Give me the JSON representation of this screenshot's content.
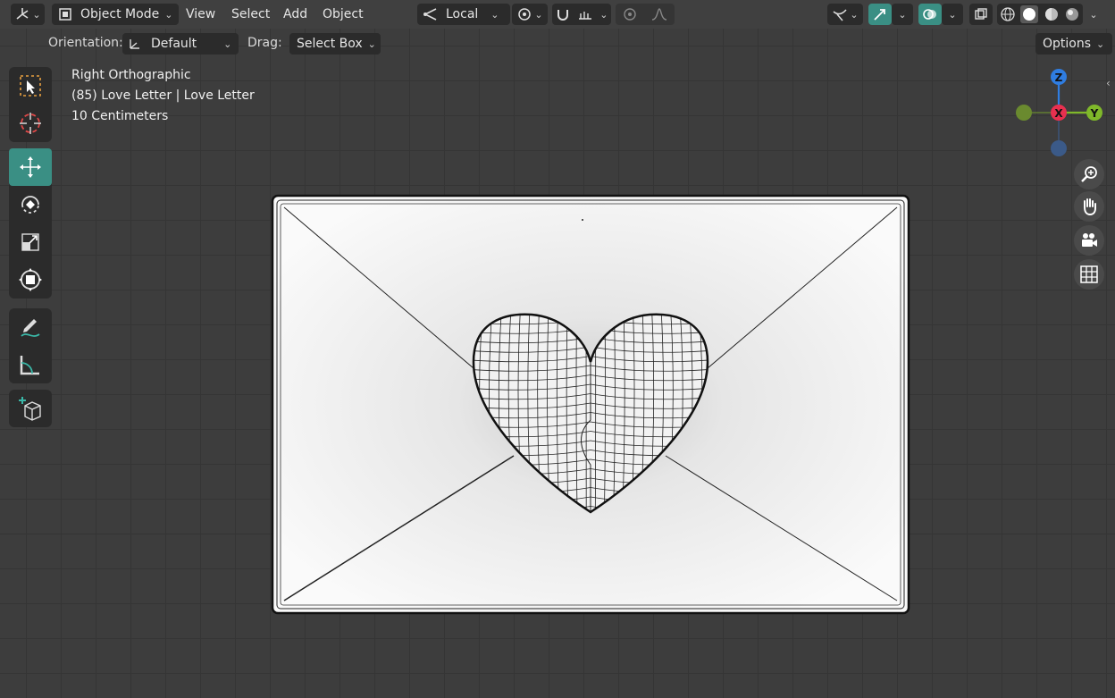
{
  "header": {
    "editor_type_icon": "orbit-axes-icon",
    "mode": {
      "label": "Object Mode",
      "icon": "object-cube-icon"
    },
    "menu": [
      "View",
      "Select",
      "Add",
      "Object"
    ],
    "transform_orientation": {
      "label": "Local",
      "icon": "local-axis-icon"
    }
  },
  "tool_settings": {
    "orientation_label": "Orientation:",
    "orientation_value": "Default",
    "drag_label": "Drag:",
    "drag_value": "Select Box",
    "options_label": "Options"
  },
  "overlay_info": {
    "view_name": "Right Orthographic",
    "object_info": "(85) Love Letter | Love Letter",
    "scale": "10 Centimeters"
  },
  "gizmo": {
    "axes": [
      {
        "label": "Z",
        "color": "#2f7de1"
      },
      {
        "label": "X",
        "color": "#e8304f"
      },
      {
        "label": "Y",
        "color": "#7fb82a"
      }
    ],
    "neg_y_color": "#6a8a2f",
    "neg_z_color": "#3b5a88"
  },
  "colors": {
    "accent": "#3a8f84",
    "header_bg": "#404040",
    "viewport_bg": "#3d3d3d"
  },
  "tools": [
    "select-box-icon",
    "cursor-icon",
    "move-icon",
    "rotate-icon",
    "scale-icon",
    "transform-icon",
    "annotate-icon",
    "measure-icon",
    "add-cube-icon"
  ],
  "nav_buttons": [
    "zoom-icon",
    "pan-hand-icon",
    "camera-icon",
    "grid-icon"
  ]
}
